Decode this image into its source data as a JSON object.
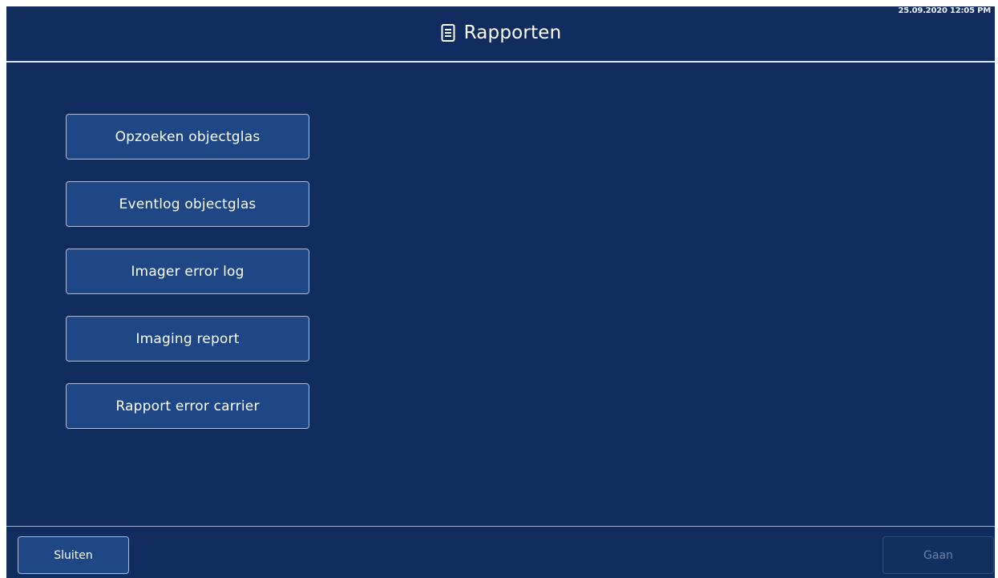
{
  "header": {
    "title": "Rapporten",
    "timestamp": "25.09.2020 12:05 PM",
    "icon": "document-icon"
  },
  "menu": {
    "items": [
      {
        "label": "Opzoeken objectglas"
      },
      {
        "label": "Eventlog objectglas"
      },
      {
        "label": "Imager error log"
      },
      {
        "label": "Imaging report"
      },
      {
        "label": "Rapport error carrier"
      }
    ]
  },
  "footer": {
    "close_label": "Sluiten",
    "go_label": "Gaan"
  },
  "colors": {
    "background": "#112c5f",
    "button": "#1f4685",
    "border": "#a8b8da",
    "disabled_text": "#6d82a9"
  }
}
